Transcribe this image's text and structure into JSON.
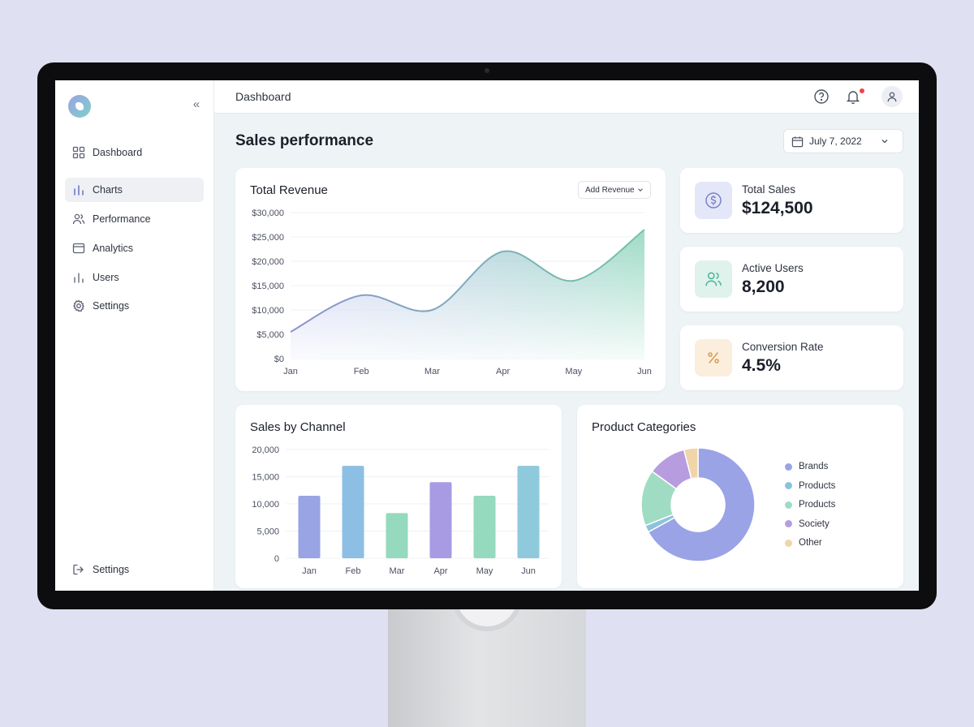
{
  "topbar": {
    "title": "Dashboard"
  },
  "sidebar": {
    "items": [
      {
        "label": "Dashboard",
        "icon": "grid-icon"
      },
      {
        "label": "Charts",
        "icon": "bar-chart-icon",
        "active": true
      },
      {
        "label": "Performance",
        "icon": "users-icon"
      },
      {
        "label": "Analytics",
        "icon": "browser-icon"
      },
      {
        "label": "Users",
        "icon": "bar-chart-icon"
      },
      {
        "label": "Settings",
        "icon": "gear-icon"
      }
    ],
    "footer": {
      "label": "Settings",
      "icon": "logout-icon"
    }
  },
  "page": {
    "title": "Sales performance",
    "date": "July 7, 2022"
  },
  "stats": [
    {
      "label": "Total Sales",
      "value": "$124,500",
      "icon": "dollar-icon",
      "color": "#e4e7f8",
      "icon_color": "#7b82c9"
    },
    {
      "label": "Active Users",
      "value": "8,200",
      "icon": "users-icon",
      "color": "#dff2ec",
      "icon_color": "#4db395"
    },
    {
      "label": "Conversion Rate",
      "value": "4.5%",
      "icon": "percent-icon",
      "color": "#fbeedd",
      "icon_color": "#d99a4e"
    }
  ],
  "revenue": {
    "title": "Total Revenue",
    "button": "Add Revenue"
  },
  "channel": {
    "title": "Sales by Channel"
  },
  "categories": {
    "title": "Product Categories"
  },
  "chart_data": [
    {
      "type": "area",
      "title": "Total Revenue",
      "x": [
        "Jan",
        "Feb",
        "Mar",
        "Apr",
        "May",
        "Jun"
      ],
      "y": [
        5500,
        13000,
        10000,
        22000,
        16000,
        26500
      ],
      "ylim": [
        0,
        30000
      ],
      "yticks": [
        "$0",
        "$5,000",
        "$10,000",
        "$15,000",
        "$20,000",
        "$25,000",
        "$30,000"
      ],
      "grid": true,
      "colors": [
        "#9aa3e6",
        "#7fd0b2"
      ]
    },
    {
      "type": "bar",
      "title": "Sales by Channel",
      "categories": [
        "Jan",
        "Feb",
        "Mar",
        "Apr",
        "May",
        "Jun"
      ],
      "values": [
        11500,
        17000,
        8300,
        14000,
        11500,
        17000
      ],
      "ylim": [
        0,
        20000
      ],
      "yticks": [
        "0",
        "5,000",
        "10,000",
        "15,000",
        "20,000"
      ],
      "grid": true,
      "colors": [
        "#98a4e3",
        "#8cbfe3",
        "#95d9bf",
        "#a89be3",
        "#95d9bf",
        "#8ec9dc"
      ]
    },
    {
      "type": "pie",
      "title": "Product Categories",
      "labels": [
        "Brands",
        "Products",
        "Products",
        "Society",
        "Other"
      ],
      "values": [
        67,
        2,
        16,
        11,
        4
      ],
      "colors": [
        "#9aa3e6",
        "#8cc3dc",
        "#9fdcc3",
        "#b79ce0",
        "#efd5aa"
      ],
      "legend": "right"
    }
  ]
}
